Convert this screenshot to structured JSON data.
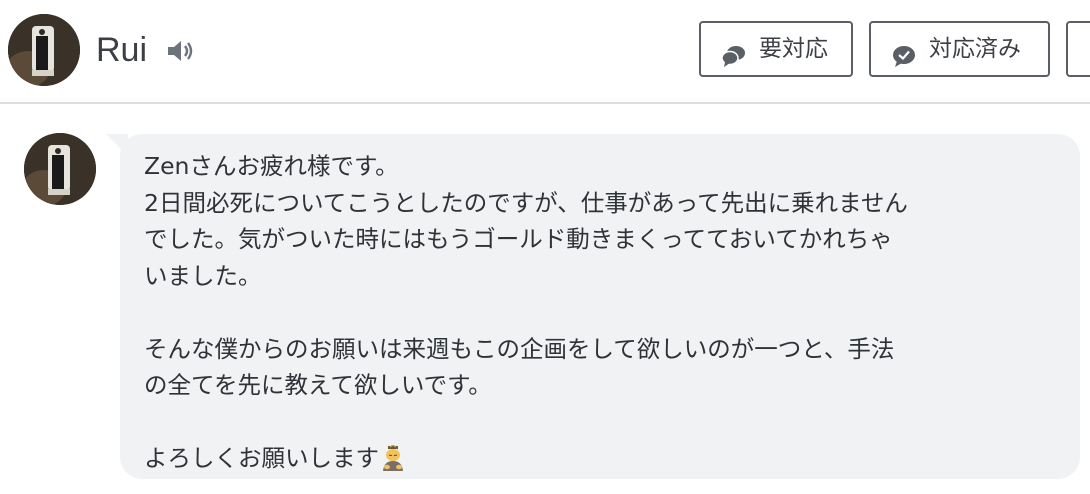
{
  "header": {
    "user_name": "Rui",
    "speaker_icon": "speaker-icon",
    "buttons": {
      "needs_action": {
        "label": "要対応",
        "icon": "chat-bubble-icon"
      },
      "done": {
        "label": "対応済み",
        "icon": "check-bubble-icon"
      },
      "more": {
        "label": "",
        "icon": "bubble-icon"
      }
    }
  },
  "message": {
    "lines": [
      "Zenさんお疲れ様です。",
      "2日間必死についてこうとしたのですが、仕事があって先出に乗れません",
      "でした。気がついた時にはもうゴールド動きまくってておいてかれちゃ",
      "いました。",
      "",
      "そんな僕からのお願いは来週もこの企画をして欲しいのが一つと、手法",
      "の全てを先に教えて欲しいです。",
      "",
      "よろしくお願いします"
    ],
    "trailing_emoji": "person-bowing-emoji"
  },
  "colors": {
    "bubble_bg": "#f1f2f4",
    "text": "#2f3237",
    "border": "#5a5f66",
    "divider": "#dcdde0"
  }
}
